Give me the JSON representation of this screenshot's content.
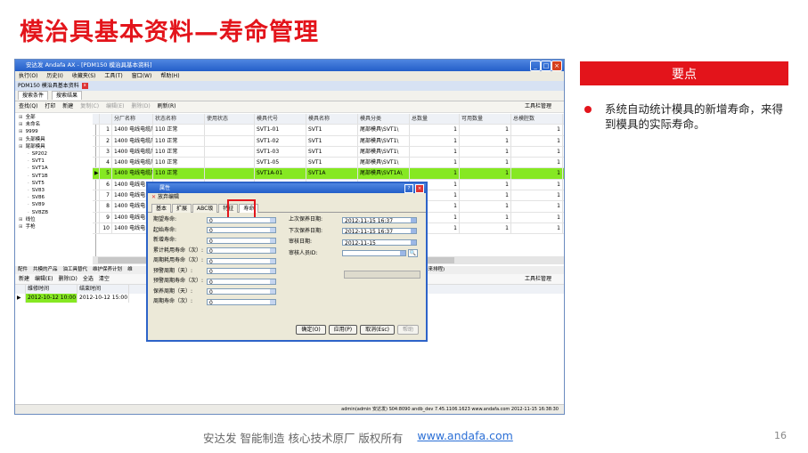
{
  "slide": {
    "title": "模治具基本资料—寿命管理",
    "panel_header": "要点",
    "panel_text": "系统自动统计模具的新增寿命，来得到模具的实际寿命。",
    "footer_text": "安达发   智能制造 核心技术原厂   版权所有",
    "footer_link": "www.andafa.com",
    "page_number": "16",
    "accent_color": "#e3141b"
  },
  "app": {
    "window_title": "安达发 Andafa AX - [PDM150 模治具基本资料]",
    "menu": [
      "执行(O)",
      "历史(I)",
      "收藏夹(S)",
      "工具(T)",
      "窗口(W)",
      "帮助(H)"
    ],
    "module_tab": "PDM150 模治具基本资料",
    "sub_tabs": [
      "搜索条件",
      "搜索结果"
    ],
    "toolbar": [
      "查找(Q)",
      "打印",
      "新建",
      "复制(C)",
      "编辑(E)",
      "删除(D)",
      "刷新(R)"
    ],
    "toolbar_right": "工具栏管理",
    "tree": [
      "全部",
      "未命名",
      "9999",
      "头部模具",
      "尾部模具",
      "SP202",
      "SVT1",
      "SVT1A",
      "SVT1B",
      "SVT5",
      "SV83",
      "SV86",
      "SV89",
      "SV8ZB",
      "线位",
      "手枪"
    ],
    "grid": {
      "columns": [
        "",
        "",
        "分厂名称",
        "状态名称",
        "使用状态",
        "模具代号",
        "模具名称",
        "模具分类",
        "总数量",
        "可用数量",
        "总模腔数"
      ],
      "rows": [
        [
          "",
          "1",
          "1400 电线电缆厂",
          "110 正常",
          "",
          "SVT1-01",
          "SVT1",
          "尾部模具\\SVT1\\",
          "1",
          "1",
          "1"
        ],
        [
          "",
          "2",
          "1400 电线电缆厂",
          "110 正常",
          "",
          "SVT1-02",
          "SVT1",
          "尾部模具\\SVT1\\",
          "1",
          "1",
          "1"
        ],
        [
          "",
          "3",
          "1400 电线电缆厂",
          "110 正常",
          "",
          "SVT1-03",
          "SVT1",
          "尾部模具\\SVT1\\",
          "1",
          "1",
          "1"
        ],
        [
          "",
          "4",
          "1400 电线电缆厂",
          "110 正常",
          "",
          "SVT1-05",
          "SVT1",
          "尾部模具\\SVT1\\",
          "1",
          "1",
          "1"
        ],
        [
          "▶",
          "5",
          "1400 电线电缆厂",
          "110 正常",
          "",
          "SVT1A-01",
          "SVT1A",
          "尾部模具\\SVT1A\\",
          "1",
          "1",
          "1"
        ],
        [
          "",
          "6",
          "1400 电线电",
          "",
          "",
          "",
          "",
          "",
          "1",
          "1",
          "1"
        ],
        [
          "",
          "7",
          "1400 电线电",
          "",
          "",
          "",
          "",
          "",
          "1",
          "1",
          "1"
        ],
        [
          "",
          "8",
          "1400 电线电",
          "",
          "",
          "",
          "",
          "",
          "1",
          "1",
          "1"
        ],
        [
          "",
          "9",
          "1400 电线电",
          "",
          "",
          "",
          "",
          "",
          "1",
          "1",
          "1"
        ],
        [
          "",
          "10",
          "1400 电线电",
          "",
          "",
          "",
          "",
          "",
          "1",
          "1",
          "1"
        ]
      ]
    },
    "bottom_tabs": [
      "配件",
      "共模的产品",
      "油工具替代",
      "维护保养计划",
      "维"
    ],
    "bottom_tab_right": "外来排程)",
    "bottom_toolbar": [
      "新建",
      "编辑(E)",
      "删除(D)",
      "全选",
      "清空"
    ],
    "bottom_toolbar_right": "工具栏管理",
    "bottom_grid": {
      "columns": [
        "维修时间",
        "结束时间"
      ],
      "rows": [
        [
          "2012-10-12 10:00",
          "2012-10-12 15:00"
        ]
      ]
    },
    "status_bar": "admin(admin 安达发)  S04:8090  andb_dev  7.45.1106.1623  www.andafa.com  2012-11-15 16:38:30"
  },
  "dialog": {
    "title": "属性",
    "subtitle": "放弃编辑",
    "tabs": [
      "基本",
      "扩展",
      "ABC级",
      "特征",
      "寿命"
    ],
    "active_tab": "寿命",
    "left_fields": [
      {
        "label": "期望寿命:",
        "value": "0"
      },
      {
        "label": "起始寿命:",
        "value": "0"
      },
      {
        "label": "新增寿命:",
        "value": "0"
      },
      {
        "label": "累计耗用寿命（次）:",
        "value": "0"
      },
      {
        "label": "周期耗用寿命（次）:",
        "value": "0"
      },
      {
        "label": "预警周期（天）:",
        "value": "0"
      },
      {
        "label": "预警周期寿命（次）:",
        "value": "0"
      },
      {
        "label": "保养周期（天）:",
        "value": "0"
      },
      {
        "label": "周期寿命（次）:",
        "value": "0"
      }
    ],
    "right_fields": [
      {
        "label": "上次保养日期:",
        "value": "2012-11-15 16:37"
      },
      {
        "label": "下次保养日期:",
        "value": "2012-11-15 16:37"
      },
      {
        "label": "审核日期:",
        "value": "2012-11-15"
      },
      {
        "label": "审核人员ID:",
        "value": ""
      }
    ],
    "buttons": [
      "确定(O)",
      "应用(P)",
      "取消(Esc)",
      "帮助"
    ]
  }
}
